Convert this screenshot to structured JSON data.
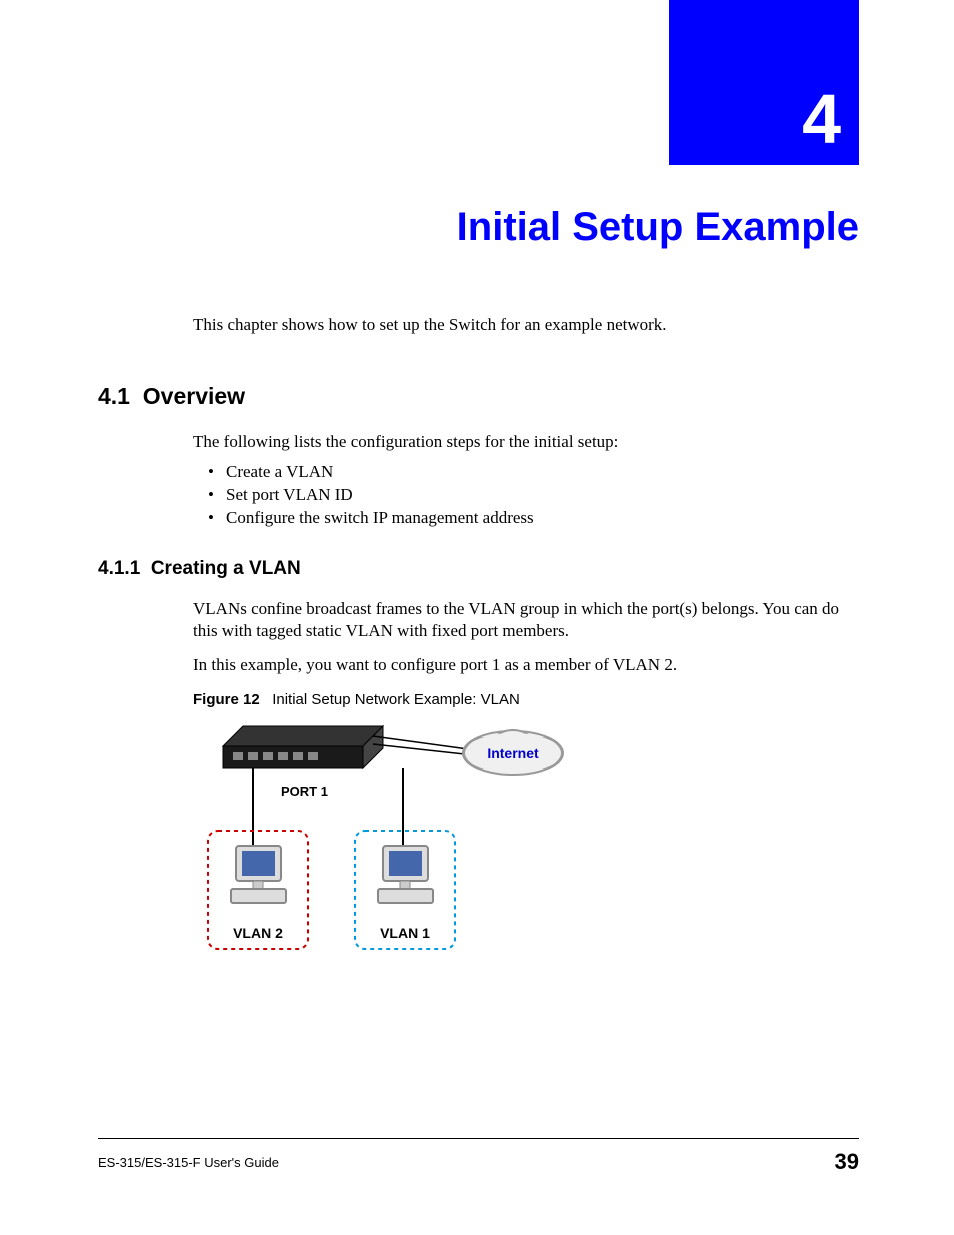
{
  "chapter": {
    "number": "4",
    "title": "Initial Setup Example"
  },
  "intro": "This  chapter shows how to set up the Switch for an example network.",
  "section": {
    "number": "4.1",
    "title": "Overview",
    "text": "The following lists the configuration steps for the initial setup:",
    "bullets": [
      "Create a VLAN",
      "Set port VLAN ID",
      "Configure the switch IP management address"
    ]
  },
  "subsection": {
    "number": "4.1.1",
    "title": "Creating a VLAN",
    "para1": "VLANs confine broadcast frames to the VLAN group in which the port(s) belongs. You can do this with tagged static VLAN with fixed port members.",
    "para2": "In this example, you want to configure port 1 as a member of VLAN 2."
  },
  "figure": {
    "label": "Figure 12",
    "caption": "Initial Setup Network Example: VLAN",
    "labels": {
      "internet": "Internet",
      "port1": "PORT 1",
      "vlan2": "VLAN 2",
      "vlan1": "VLAN 1"
    }
  },
  "footer": {
    "guide": "ES-315/ES-315-F User's Guide",
    "page": "39"
  }
}
